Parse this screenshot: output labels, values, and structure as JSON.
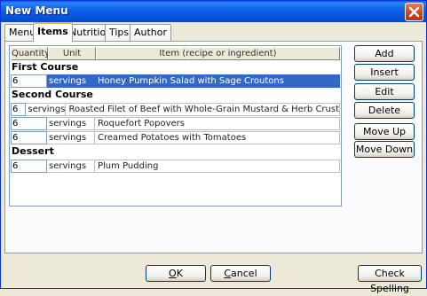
{
  "window": {
    "title": "New Menu"
  },
  "tabs": [
    {
      "label": "Menu"
    },
    {
      "label": "Items"
    },
    {
      "label": "Nutrition"
    },
    {
      "label": "Tips"
    },
    {
      "label": "Author"
    }
  ],
  "table": {
    "headers": [
      "Quantity",
      "Unit",
      "Item (recipe or ingredient)"
    ],
    "sections": [
      {
        "name": "First Course",
        "rows": [
          {
            "quantity": "6",
            "unit": "servings",
            "item": "Honey Pumpkin Salad with Sage Croutons",
            "selected": true
          }
        ]
      },
      {
        "name": "Second Course",
        "rows": [
          {
            "quantity": "6",
            "unit": "servings",
            "item": "Roasted Filet of Beef with Whole-Grain Mustard & Herb Crust"
          },
          {
            "quantity": "6",
            "unit": "servings",
            "item": "Roquefort Popovers"
          },
          {
            "quantity": "6",
            "unit": "servings",
            "item": "Creamed Potatoes with Tomatoes"
          }
        ]
      },
      {
        "name": "Dessert",
        "rows": [
          {
            "quantity": "6",
            "unit": "servings",
            "item": "Plum Pudding"
          }
        ]
      }
    ]
  },
  "side_buttons": {
    "add": "Add",
    "insert": "Insert",
    "edit": "Edit",
    "delete": "Delete",
    "move_up": "Move Up",
    "move_down": "Move Down"
  },
  "footer": {
    "ok_u": "O",
    "ok_rest": "K",
    "cancel_u": "C",
    "cancel_rest": "ancel",
    "check_spelling": "Check Spelling"
  },
  "colors": {
    "titlebar": "#0a5de0",
    "selection": "#316ac5",
    "active_tab_accent": "#f5b546",
    "close_button": "#c9431d"
  },
  "icons": {
    "close": "close-icon"
  }
}
